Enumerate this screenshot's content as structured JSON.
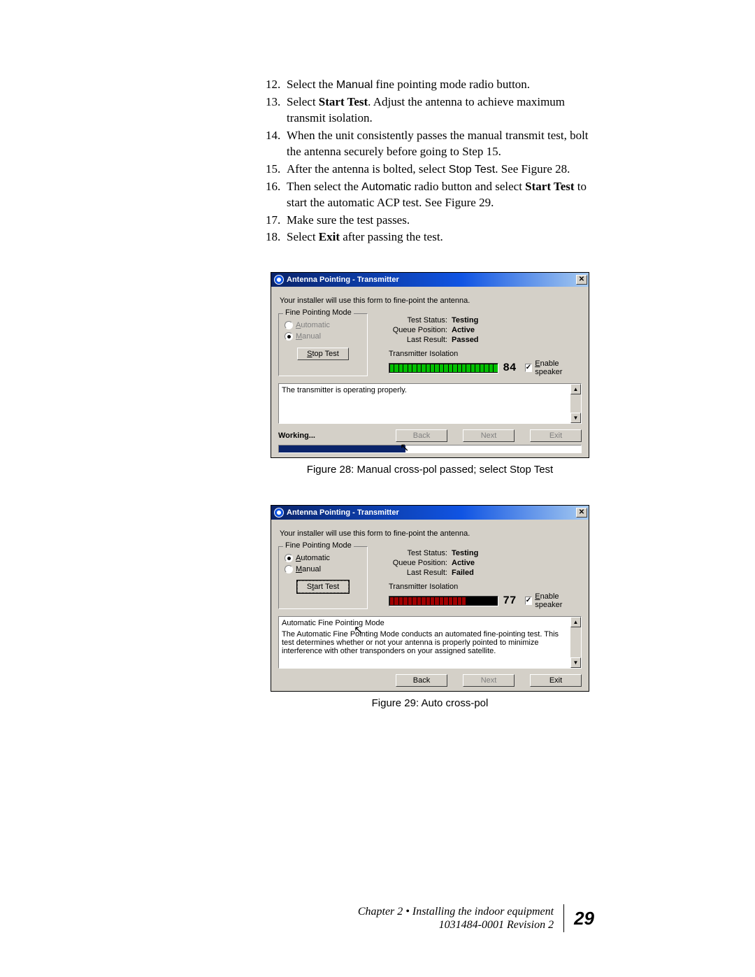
{
  "steps": [
    {
      "n": "12.",
      "html": "Select the <span class='sans'>Manual</span> fine pointing mode radio button."
    },
    {
      "n": "13.",
      "html": "Select <b>Start Test</b>. Adjust the antenna to achieve maximum transmit isolation."
    },
    {
      "n": "14.",
      "html": "When the unit consistently passes the manual transmit test, bolt the antenna securely before going to Step 15."
    },
    {
      "n": "15.",
      "html": "After the antenna is bolted, select <span class='sans'>Stop Test</span>. See Figure 28."
    },
    {
      "n": "16.",
      "html": "Then select the <span class='sans'>Automatic</span> radio button and select <b>Start Test</b> to start the automatic ACP test. See Figure 29."
    },
    {
      "n": "17.",
      "html": "Make sure the test passes."
    },
    {
      "n": "18.",
      "html": "Select <b>Exit</b> after passing the test."
    }
  ],
  "fig28": {
    "title": "Antenna Pointing - Transmitter",
    "intro": "Your installer will use this form to fine-point the antenna.",
    "fieldset_legend": "Fine Pointing Mode",
    "radio_auto": "Automatic",
    "radio_manual": "Manual",
    "btn_stop": "Stop Test",
    "stats": {
      "status_lbl": "Test Status:",
      "status_val": "Testing",
      "queue_lbl": "Queue Position:",
      "queue_val": "Active",
      "result_lbl": "Last Result:",
      "result_val": "Passed"
    },
    "iso_label": "Transmitter Isolation",
    "iso_value": "84",
    "enable_speaker": "Enable speaker",
    "msg": "The transmitter is operating properly.",
    "working": "Working...",
    "back": "Back",
    "next": "Next",
    "exit": "Exit",
    "caption": "Figure 28: Manual cross-pol passed; select Stop Test"
  },
  "fig29": {
    "title": "Antenna Pointing - Transmitter",
    "intro": "Your installer will use this form to fine-point the antenna.",
    "fieldset_legend": "Fine Pointing Mode",
    "radio_auto": "Automatic",
    "radio_manual": "Manual",
    "btn_start": "Start Test",
    "stats": {
      "status_lbl": "Test Status:",
      "status_val": "Testing",
      "queue_lbl": "Queue Position:",
      "queue_val": "Active",
      "result_lbl": "Last Result:",
      "result_val": "Failed"
    },
    "iso_label": "Transmitter Isolation",
    "iso_value": "77",
    "enable_speaker": "Enable speaker",
    "msg_title": "Automatic Fine Pointing Mode",
    "msg_body": "The Automatic Fine Pointing Mode conducts an automated fine-pointing test. This test determines whether or not your antenna is properly pointed to minimize interference with other transponders on your assigned satellite.",
    "back": "Back",
    "next": "Next",
    "exit": "Exit",
    "caption": "Figure 29: Auto cross-pol"
  },
  "footer": {
    "chapter": "Chapter 2 • Installing the indoor equipment",
    "doc": "1031484-0001  Revision 2",
    "page": "29"
  }
}
